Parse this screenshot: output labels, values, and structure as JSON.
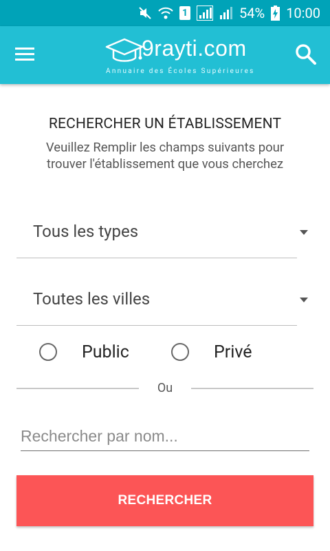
{
  "status_bar": {
    "battery": "54%",
    "time": "10:00",
    "sim": "1",
    "icons": [
      "mute-icon",
      "wifi-icon",
      "sim-icon",
      "signal-icon",
      "signal-icon",
      "battery-charging-icon"
    ]
  },
  "app_bar": {
    "logo_text": "9rayti.com",
    "logo_tagline": "Annuaire des Écoles Supérieures",
    "menu_icon": "menu-icon",
    "search_icon": "search-icon",
    "color": "#22bfd4",
    "status_color": "#00a3b8"
  },
  "form": {
    "title": "RECHERCHER UN ÉTABLISSEMENT",
    "subtitle": "Veuillez Remplir les champs suivants pour trouver l'établissement que vous cherchez",
    "type_select": "Tous les types",
    "city_select": "Toutes les villes",
    "radio_public": "Public",
    "radio_private": "Privé",
    "or_label": "Ou",
    "name_placeholder": "Rechercher par nom...",
    "name_value": "",
    "submit_label": "RECHERCHER",
    "submit_color": "#fc5556"
  }
}
